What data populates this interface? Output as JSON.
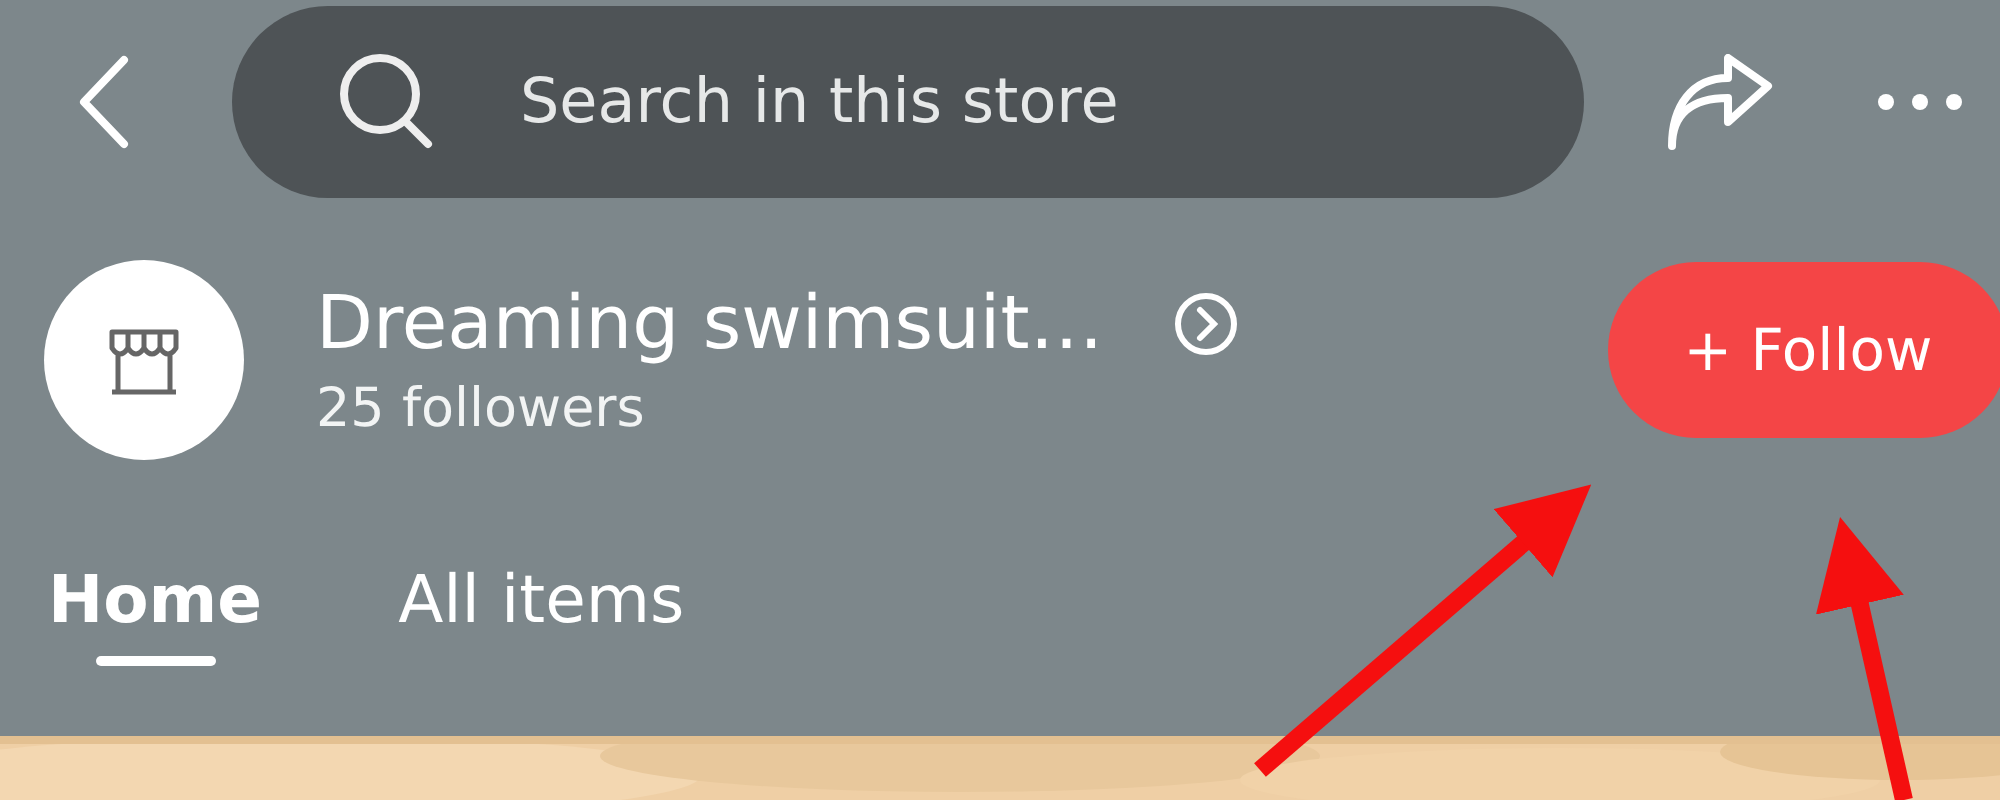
{
  "search": {
    "placeholder": "Search in this store"
  },
  "store": {
    "name": "Dreaming swimsuit…",
    "followers": "25 followers"
  },
  "follow_button": {
    "label": "+ Follow"
  },
  "tabs": [
    {
      "label": "Home",
      "selected": true
    },
    {
      "label": "All items",
      "selected": false
    }
  ]
}
